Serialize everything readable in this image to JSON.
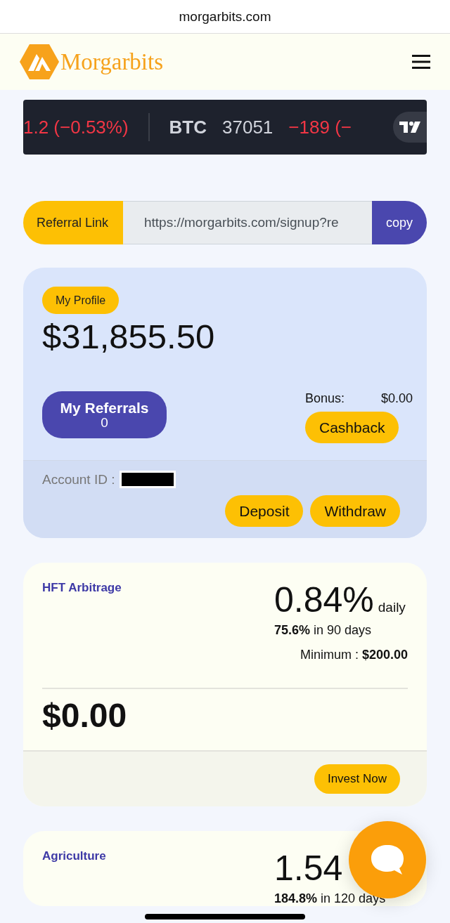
{
  "browser": {
    "address": "morgarbits.com"
  },
  "header": {
    "brand": "Morgarbits"
  },
  "ticker": [
    {
      "change": "1.2 (−0.53%)"
    },
    {
      "symbol": "BTC",
      "price": "37051",
      "change": "−189 (−"
    }
  ],
  "referral": {
    "label": "Referral Link",
    "url": "https://morgarbits.com/signup?re",
    "button": "copy"
  },
  "profile": {
    "badge": "My Profile",
    "balance": "$31,855.50",
    "referrals": {
      "label": "My Referrals",
      "count": "0"
    },
    "bonus_label": "Bonus:",
    "bonus_value": "$0.00",
    "cashback": "Cashback",
    "account_label": "Account ID :",
    "buttons": [
      "Deposit",
      "Withdraw"
    ]
  },
  "plans": [
    {
      "name": "HFT Arbitrage",
      "rate": "0.84%",
      "period": "daily",
      "total": "**75.6%** in 90 days",
      "minimum": "Minimum : **$200.00**",
      "amount": "$0.00",
      "button": "Invest Now"
    },
    {
      "name": "Agriculture",
      "rate": "1.54",
      "total": "**184.8%** in 120 days"
    }
  ]
}
